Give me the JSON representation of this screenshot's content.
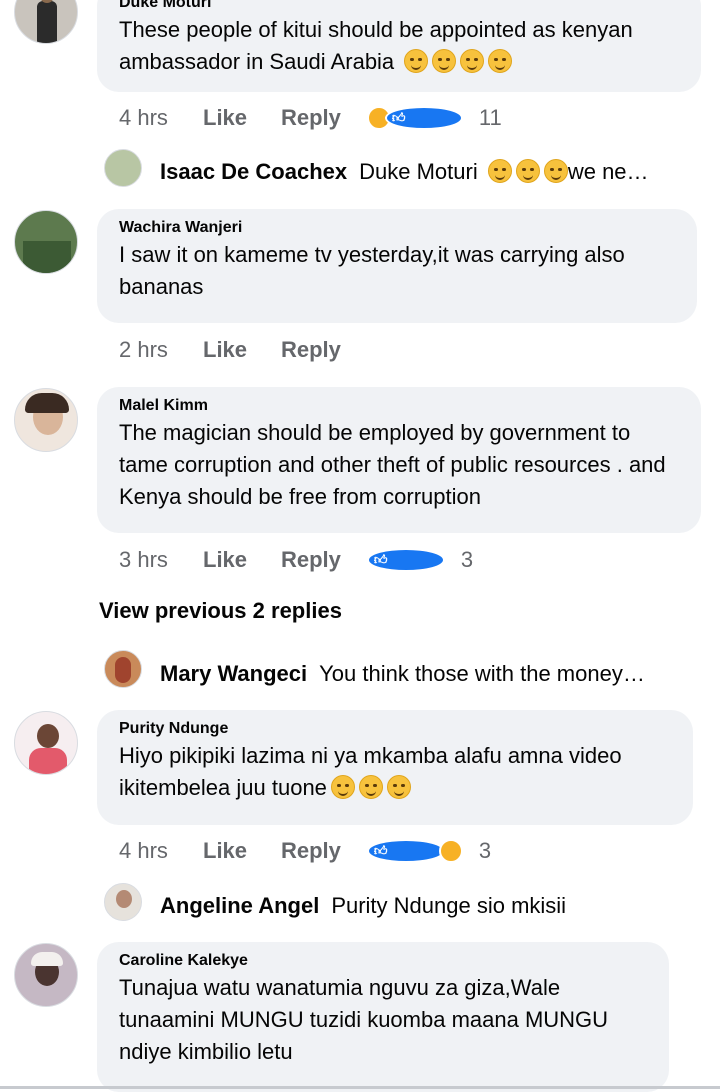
{
  "comments": [
    {
      "author": "Duke Moturi",
      "text": "These people of kitui should be appointed as kenyan ambassador in Saudi Arabia",
      "emojis": [
        "relieved",
        "relieved",
        "pensive",
        "pensive"
      ],
      "time": "4 hrs",
      "like": "Like",
      "reply": "Reply",
      "reactions": [
        "haha",
        "like"
      ],
      "reaction_count": "11"
    },
    {
      "author": "Wachira Wanjeri",
      "text": "I saw it on kameme tv yesterday,it was carrying also bananas",
      "time": "2 hrs",
      "like": "Like",
      "reply": "Reply"
    },
    {
      "author": "Malel Kimm",
      "text": "The magician should be employed by government to tame corruption and other theft of public resources . and Kenya should be free from corruption",
      "time": "3 hrs",
      "like": "Like",
      "reply": "Reply",
      "reactions": [
        "like"
      ],
      "reaction_count": "3"
    },
    {
      "author": "Purity Ndunge",
      "text": "Hiyo pikipiki lazima ni ya mkamba alafu amna video ikitembelea  juu tuone",
      "emojis": [
        "joy",
        "joy",
        "joy"
      ],
      "time": "4 hrs",
      "like": "Like",
      "reply": "Reply",
      "reactions": [
        "like",
        "haha"
      ],
      "reaction_count": "3"
    },
    {
      "author": "Caroline Kalekye",
      "text": "Tunajua watu wanatumia nguvu za giza,Wale tunaamini MUNGU tuzidi kuomba maana MUNGU ndiye kimbilio letu"
    }
  ],
  "replies": [
    {
      "author": "Isaac De Coachex",
      "text": "Duke Moturi",
      "suffix": "we ne…",
      "emojis": [
        "rofl",
        "rofl",
        "rofl"
      ]
    },
    {
      "author": "Mary Wangeci",
      "text": "You think those with the money…"
    },
    {
      "author": "Angeline Angel",
      "text": "Purity Ndunge sio mkisii"
    }
  ],
  "view_previous": "View previous 2 replies"
}
